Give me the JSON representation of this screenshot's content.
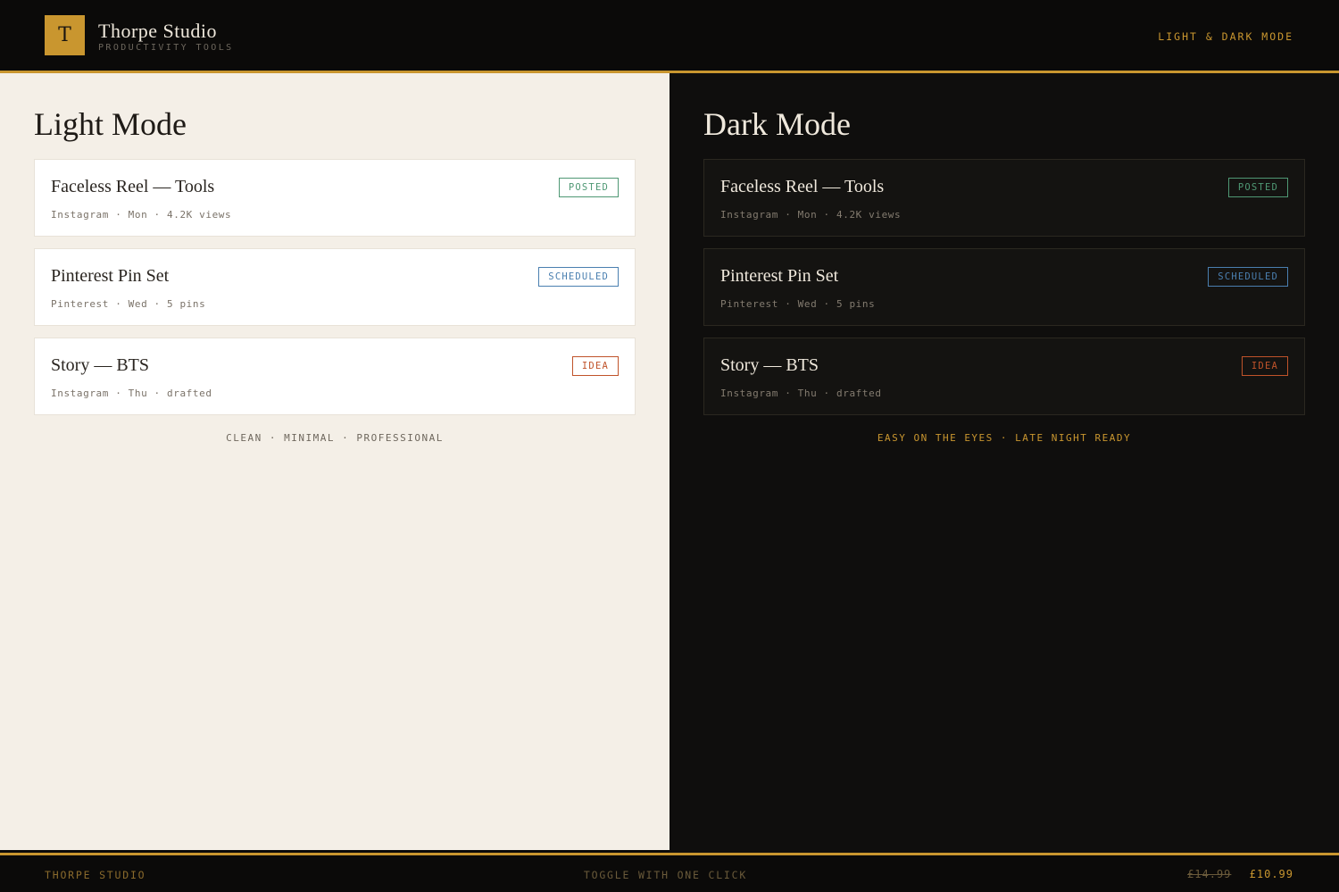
{
  "header": {
    "logo_letter": "T",
    "brand_name": "Thorpe Studio",
    "brand_sub": "PRODUCTIVITY TOOLS",
    "mode_label": "LIGHT & DARK MODE"
  },
  "light": {
    "title": "Light Mode",
    "cards": [
      {
        "title": "Faceless Reel — Tools",
        "meta": "Instagram · Mon · 4.2K views",
        "badge": "POSTED"
      },
      {
        "title": "Pinterest Pin Set",
        "meta": "Pinterest · Wed · 5 pins",
        "badge": "SCHEDULED"
      },
      {
        "title": "Story — BTS",
        "meta": "Instagram · Thu · drafted",
        "badge": "IDEA"
      }
    ],
    "tagline": "CLEAN · MINIMAL · PROFESSIONAL"
  },
  "dark": {
    "title": "Dark Mode",
    "cards": [
      {
        "title": "Faceless Reel — Tools",
        "meta": "Instagram · Mon · 4.2K views",
        "badge": "POSTED"
      },
      {
        "title": "Pinterest Pin Set",
        "meta": "Pinterest · Wed · 5 pins",
        "badge": "SCHEDULED"
      },
      {
        "title": "Story — BTS",
        "meta": "Instagram · Thu · drafted",
        "badge": "IDEA"
      }
    ],
    "tagline": "EASY ON THE EYES · LATE NIGHT READY"
  },
  "footer": {
    "brand": "THORPE STUDIO",
    "cta": "TOGGLE WITH ONE CLICK",
    "old_price": "£14.99",
    "new_price": "£10.99"
  },
  "colors": {
    "accent": "#c9962f",
    "posted": "#4f9874",
    "scheduled": "#4a7fb0",
    "idea": "#c0532a",
    "light_bg": "#f4efe7",
    "dark_bg": "#0f0e0d"
  }
}
